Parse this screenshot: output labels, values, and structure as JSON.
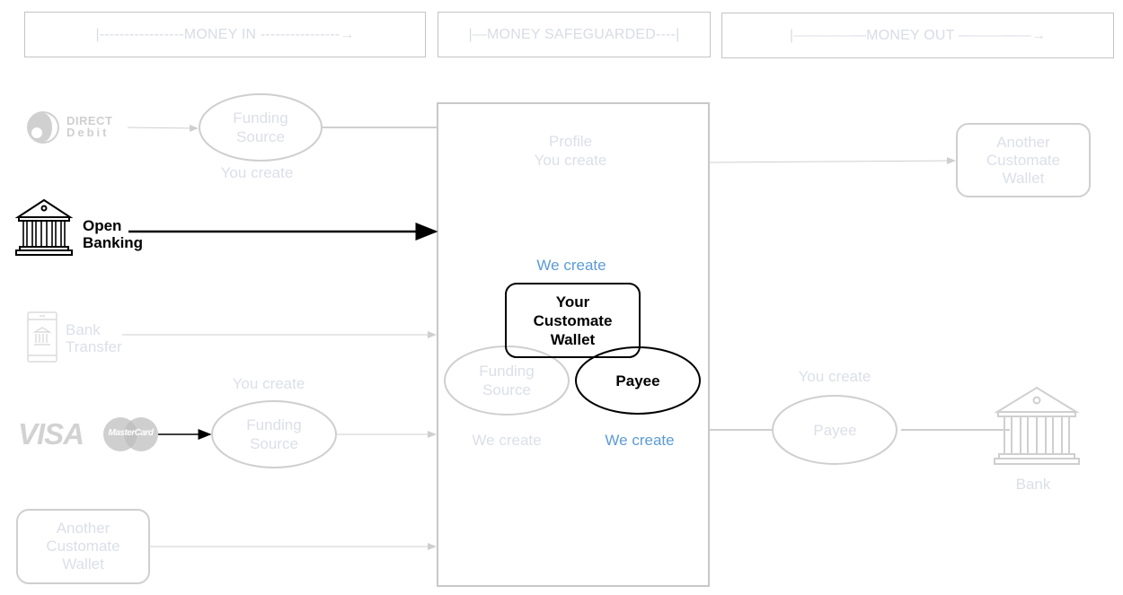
{
  "headers": {
    "money_in": "|-----------------MONEY IN ----------------→",
    "money_safeguarded": "|—MONEY SAFEGUARDED----|",
    "money_out": "|—————MONEY OUT —————→"
  },
  "sources": {
    "direct_debit": {
      "logo_line1": "DIRECT",
      "logo_line2": "Debit"
    },
    "open_banking": {
      "label_line1": "Open",
      "label_line2": "Banking"
    },
    "bank_transfer": {
      "label_line1": "Bank",
      "label_line2": "Transfer"
    },
    "cards": {
      "visa": "VISA",
      "mastercard": "MasterCard"
    },
    "another_wallet_in": {
      "line1": "Another",
      "line2": "Customate",
      "line3": "Wallet"
    }
  },
  "funding_source_top": {
    "line1": "Funding",
    "line2": "Source",
    "caption": "You create"
  },
  "funding_source_bottom": {
    "line1": "Funding",
    "line2": "Source",
    "caption": "You create"
  },
  "safeguard": {
    "profile_line1": "Profile",
    "profile_line2": "You create",
    "we_create_top": "We create",
    "wallet": {
      "line1": "Your",
      "line2": "Customate",
      "line3": "Wallet"
    },
    "funding_source": {
      "line1": "Funding",
      "line2": "Source",
      "caption": "We create"
    },
    "payee": {
      "label": "Payee",
      "caption": "We create"
    }
  },
  "out": {
    "another_wallet": {
      "line1": "Another",
      "line2": "Customate",
      "line3": "Wallet"
    },
    "payee": {
      "label": "Payee",
      "caption": "You create"
    },
    "bank": {
      "label": "Bank"
    }
  },
  "colors": {
    "faded_text": "#dcdfe8",
    "accent_blue": "#5b9bd5",
    "border_grey": "#c8c8c8",
    "active": "#000000"
  }
}
